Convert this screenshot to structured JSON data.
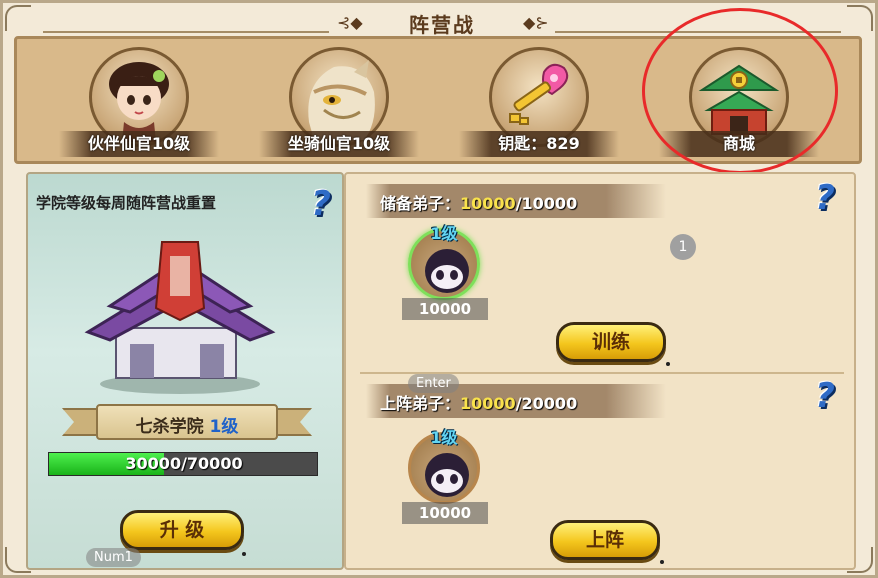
{
  "title": "阵营战",
  "top_items": [
    {
      "label": "伙伴仙官10级",
      "icon": "partner-portrait-icon"
    },
    {
      "label": "坐骑仙官10级",
      "icon": "mount-portrait-icon"
    },
    {
      "label": "钥匙：829",
      "icon": "key-icon"
    },
    {
      "label": "商城",
      "icon": "shop-building-icon"
    }
  ],
  "academy": {
    "notice": "学院等级每周随阵营战重置",
    "name": "七杀学院",
    "level": "1级",
    "progress_text": "30000/70000",
    "progress_fraction": 0.4286,
    "upgrade_label": "升 级",
    "hotkey_label": "Num1"
  },
  "reserve": {
    "label_prefix": "储备弟子：",
    "current": "10000",
    "max": "/10000",
    "unit_level": "1级",
    "unit_count": "10000",
    "badge": "1",
    "train_label": "训练"
  },
  "deployed": {
    "label_prefix": "上阵弟子：",
    "current": "10000",
    "max": "/20000",
    "unit_level": "1级",
    "unit_count": "10000",
    "deploy_label": "上阵",
    "hotkey_label": "Enter"
  },
  "help_glyph": "?",
  "colors": {
    "highlight": "#e82a2a",
    "progress": "#19b319",
    "button": "#f4c61d",
    "level_text": "#63d5f2"
  }
}
